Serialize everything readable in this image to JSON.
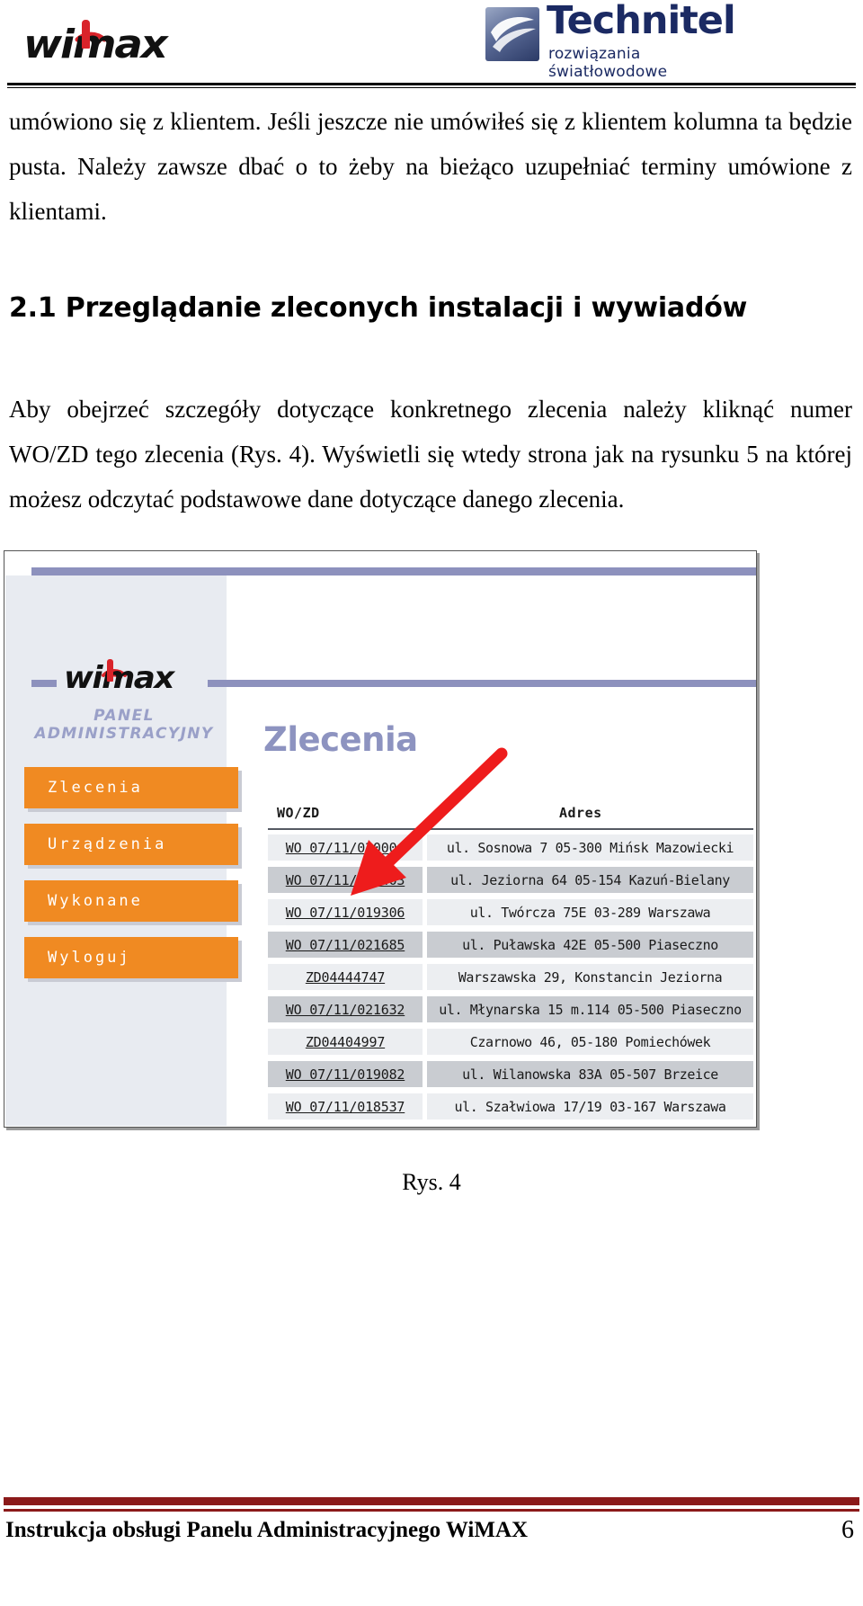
{
  "page": {
    "logo_wimax_text": "wimax",
    "logo_technitel_name": "Technitel",
    "logo_technitel_tagline": "rozwiązania światłowodowe"
  },
  "content": {
    "paragraph_1": "umówiono się z klientem. Jeśli jeszcze nie umówiłeś się z klientem kolumna ta będzie pusta. Należy zawsze dbać o to żeby na bieżąco uzupełniać terminy umówione z klientami.",
    "heading": "2.1 Przeglądanie zleconych instalacji i wywiadów",
    "paragraph_2": "Aby obejrzeć szczegóły dotyczące konkretnego zlecenia należy kliknąć numer WO/ZD tego zlecenia (Rys. 4). Wyświetli się wtedy strona jak na rysunku 5 na której możesz odczytać podstawowe dane dotyczące danego zlecenia.",
    "figure_caption": "Rys. 4"
  },
  "screenshot": {
    "logo_text": "wimax",
    "panel_label": "PANEL ADMINISTRACYJNY",
    "page_title": "Zlecenia",
    "nav_items": [
      {
        "label": "Zlecenia"
      },
      {
        "label": "Urządzenia"
      },
      {
        "label": "Wykonane"
      },
      {
        "label": "Wyloguj"
      }
    ],
    "table": {
      "columns": [
        "WO/ZD",
        "Adres"
      ],
      "rows": [
        {
          "wo": "WO 07/11/020004",
          "adres": "ul. Sosnowa 7 05-300 Mińsk Mazowiecki",
          "tone": "light"
        },
        {
          "wo": "WO 07/11/019403",
          "adres": "ul. Jeziorna 64 05-154 Kazuń-Bielany",
          "tone": "dark"
        },
        {
          "wo": "WO 07/11/019306",
          "adres": "ul. Twórcza 75E 03-289 Warszawa",
          "tone": "light"
        },
        {
          "wo": "WO 07/11/021685",
          "adres": "ul. Puławska 42E 05-500 Piaseczno",
          "tone": "dark"
        },
        {
          "wo": "ZD04444747",
          "adres": "Warszawska 29, Konstancin Jeziorna",
          "tone": "light"
        },
        {
          "wo": "WO 07/11/021632",
          "adres": "ul. Młynarska 15 m.114 05-500 Piaseczno",
          "tone": "dark"
        },
        {
          "wo": "ZD04404997",
          "adres": "Czarnowo 46, 05-180 Pomiechówek",
          "tone": "light"
        },
        {
          "wo": "WO 07/11/019082",
          "adres": "ul. Wilanowska 83A 05-507 Brzeice",
          "tone": "dark"
        },
        {
          "wo": "WO 07/11/018537",
          "adres": "ul. Szałwiowa 17/19 03-167 Warszawa",
          "tone": "light"
        }
      ]
    }
  },
  "footer": {
    "text": "Instrukcja obsługi Panelu Administracyjnego WiMAX",
    "page_number": "6"
  },
  "colors": {
    "accent_orange": "#f08a22",
    "accent_purple": "#8d91bd",
    "footer_red": "#8b1a1a",
    "logo_red": "#d9232a",
    "technitel_blue": "#1b2a63"
  }
}
